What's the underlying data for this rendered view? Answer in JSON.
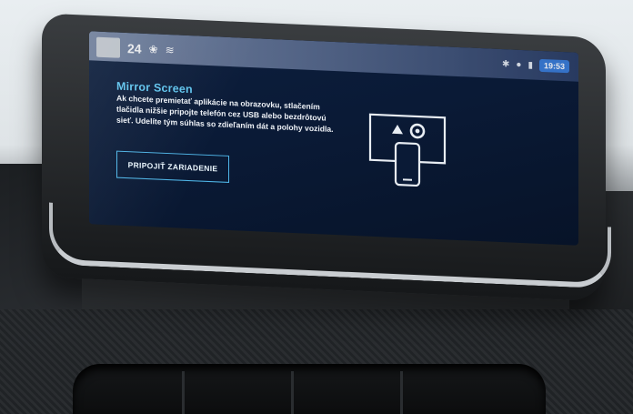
{
  "status": {
    "temperature": "24",
    "time": "19:53",
    "icons": [
      "fan-icon",
      "seat-heat-icon",
      "bluetooth-icon",
      "car-icon",
      "signal-icon"
    ]
  },
  "mirror": {
    "title": "Mirror Screen",
    "description": "Ak chcete premietať aplikácie na obrazovku, stlačením tlačidla nižšie pripojte telefón cez USB alebo bezdrôtovú sieť. Udelíte tým súhlas so zdieľaním dát a polohy vozidla.",
    "button_label": "PRIPOJIŤ ZARIADENIE"
  },
  "colors": {
    "accent": "#5fc3ec",
    "screen_bg": "#0a1a36",
    "clock_bg": "#3a7dd8"
  }
}
